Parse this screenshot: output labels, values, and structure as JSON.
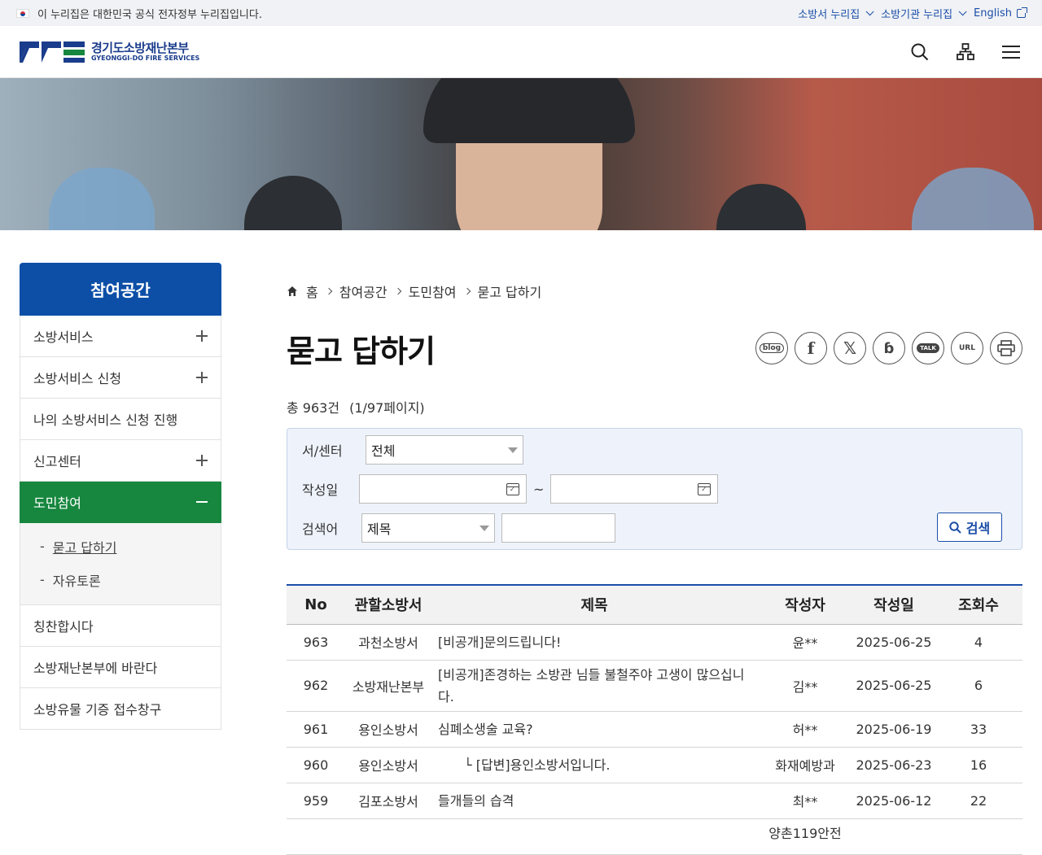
{
  "topbar": {
    "notice": "이 누리집은 대한민국 공식 전자정부 누리집입니다.",
    "links": [
      "소방서 누리집",
      "소방기관 누리집",
      "English"
    ]
  },
  "logo": {
    "ko": "경기도소방재난본부",
    "en": "GYEONGGI-DO FIRE SERVICES"
  },
  "sidebar": {
    "title": "참여공간",
    "items": [
      {
        "label": "소방서비스"
      },
      {
        "label": "소방서비스 신청"
      },
      {
        "label": "나의 소방서비스 신청 진행"
      },
      {
        "label": "신고센터"
      },
      {
        "label": "도민참여"
      },
      {
        "label": "칭찬합시다"
      },
      {
        "label": "소방재난본부에 바란다"
      },
      {
        "label": "소방유물 기증 접수창구"
      }
    ],
    "sub": [
      "묻고 답하기",
      "자유토론"
    ]
  },
  "breadcrumb": [
    "홈",
    "참여공간",
    "도민참여",
    "묻고 답하기"
  ],
  "page_title": "묻고 답하기",
  "share": [
    "blog",
    "URL"
  ],
  "count": {
    "total": "총 963건",
    "pages": "(1/97페이지)"
  },
  "search": {
    "center_label": "서/센터",
    "center_value": "전체",
    "date_label": "작성일",
    "date_sep": "~",
    "keyword_label": "검색어",
    "keyword_type": "제목",
    "button": "검색"
  },
  "table": {
    "headers": [
      "No",
      "관할소방서",
      "제목",
      "작성자",
      "작성일",
      "조회수"
    ],
    "rows": [
      [
        "963",
        "과천소방서",
        "[비공개]문의드립니다!",
        "윤**",
        "2025-06-25",
        "4"
      ],
      [
        "962",
        "소방재난본부",
        "[비공개]존경하는 소방관 님들 불철주야 고생이 많으십니다.",
        "김**",
        "2025-06-25",
        "6"
      ],
      [
        "961",
        "용인소방서",
        "심폐소생술 교육?",
        "허**",
        "2025-06-19",
        "33"
      ],
      [
        "960",
        "용인소방서",
        "└ [답변]용인소방서입니다.",
        "화재예방과",
        "2025-06-23",
        "16"
      ],
      [
        "959",
        "김포소방서",
        "들개들의 습격",
        "최**",
        "2025-06-12",
        "22"
      ]
    ],
    "partial": "양촌119안전"
  }
}
